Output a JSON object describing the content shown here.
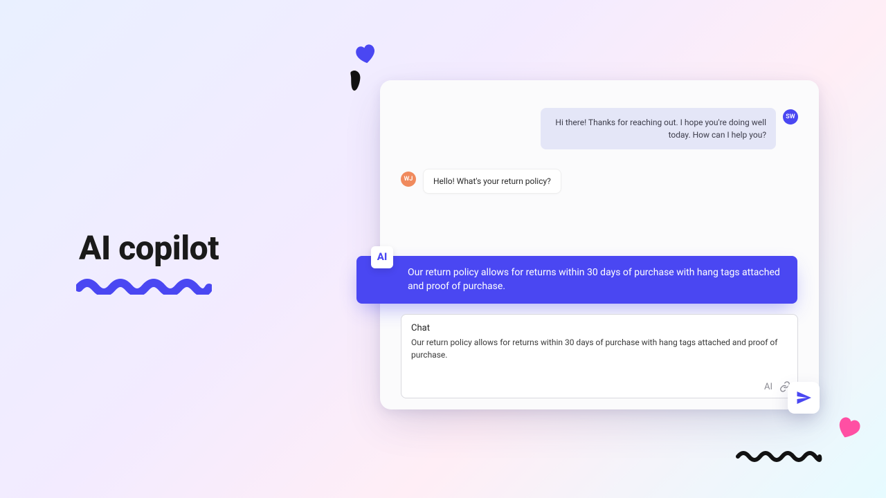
{
  "headline": "AI copilot",
  "conversation": {
    "agent": {
      "initials": "SW",
      "message": "Hi there! Thanks for reaching out. I hope you're doing well today. How can I help you?"
    },
    "user": {
      "initials": "WJ",
      "message": "Hello! What's your return policy?"
    },
    "ai_suggestion": {
      "badge": "AI",
      "text": "Our return policy allows for returns within 30 days of purchase with hang tags attached and proof of purchase."
    }
  },
  "compose": {
    "title": "Chat",
    "draft": "Our return policy allows for returns within 30 days of purchase with hang tags attached and proof of purchase.",
    "ai_toggle_label": "AI"
  },
  "colors": {
    "accent": "#4a47f2",
    "agent_bubble": "#e5e7f7",
    "user_avatar": "#f08a5d",
    "pink_heart": "#ff4fa3"
  },
  "icons": {
    "attach": "link-icon",
    "send": "paper-plane-icon",
    "heart": "heart-icon",
    "squiggle": "squiggle-icon"
  }
}
